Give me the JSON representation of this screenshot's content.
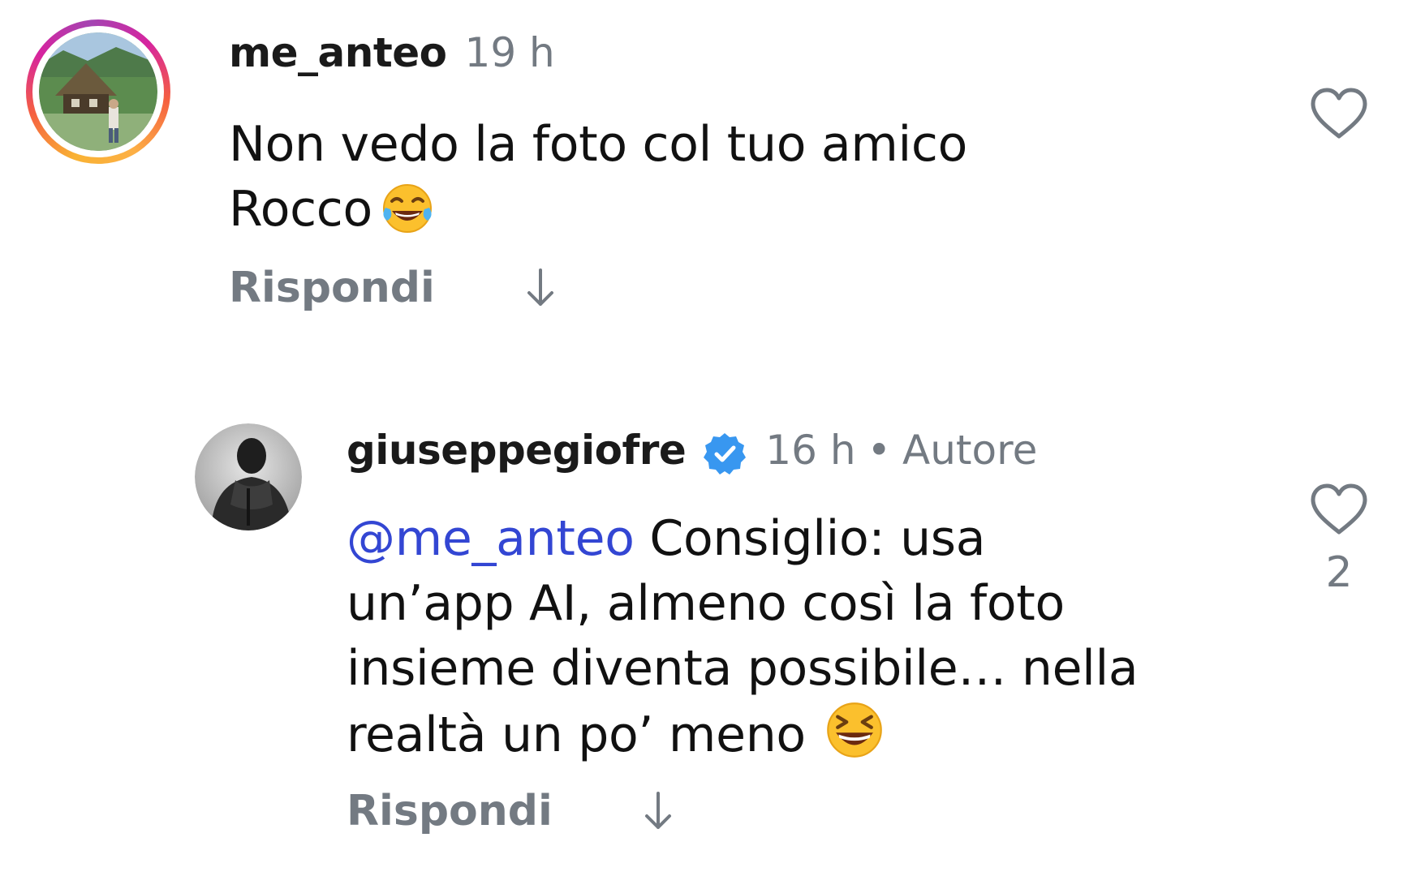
{
  "comments": [
    {
      "username": "me_anteo",
      "time": "19 h",
      "avatar_icon": "avatar-house-photo",
      "has_story_ring": true,
      "text_lines": [
        "Non vedo la foto col tuo amico",
        "Rocco"
      ],
      "emoji": "face-with-tears-of-joy",
      "reply_label": "Rispondi",
      "like_count": ""
    },
    {
      "username": "giuseppegiofre",
      "verified": true,
      "time": "16 h",
      "separator": "•",
      "author_label": "Autore",
      "avatar_icon": "avatar-bw-portrait",
      "mention": "@me_anteo",
      "text_after_mention": " Consiglio: usa",
      "text_lines": [
        "un’app AI, almeno così la foto",
        "insieme diventa possibile… nella",
        "realtà un po’ meno"
      ],
      "emoji": "grinning-squinting-face",
      "reply_label": "Rispondi",
      "like_count": "2"
    }
  ],
  "colors": {
    "mention": "#3346d3",
    "muted": "#737a82",
    "verified": "#3897f0"
  }
}
